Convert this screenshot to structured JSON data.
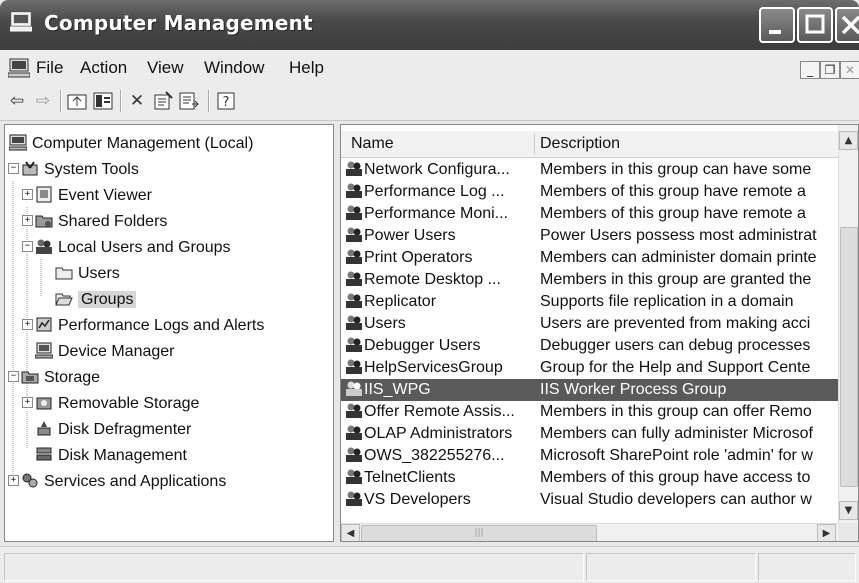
{
  "window": {
    "title": "Computer Management"
  },
  "menu": [
    "File",
    "Action",
    "View",
    "Window",
    "Help"
  ],
  "toolbar_icons": [
    "back-icon",
    "forward-icon",
    "up-icon",
    "show-hide-tree-icon",
    "delete-icon",
    "properties-icon",
    "export-list-icon",
    "help-icon"
  ],
  "tree": {
    "root": "Computer Management (Local)",
    "system_tools": "System Tools",
    "event_viewer": "Event Viewer",
    "shared_folders": "Shared Folders",
    "local_users_groups": "Local Users and Groups",
    "users": "Users",
    "groups": "Groups",
    "perf_logs": "Performance Logs and Alerts",
    "device_manager": "Device Manager",
    "storage": "Storage",
    "removable_storage": "Removable Storage",
    "disk_defrag": "Disk Defragmenter",
    "disk_mgmt": "Disk Management",
    "services_apps": "Services and Applications"
  },
  "list": {
    "columns": [
      "Name",
      "Description"
    ],
    "rows": [
      {
        "name": "Network Configura...",
        "desc": "Members in this group can have some"
      },
      {
        "name": "Performance Log ...",
        "desc": "Members of this group have remote a"
      },
      {
        "name": "Performance Moni...",
        "desc": "Members of this group have remote a"
      },
      {
        "name": "Power Users",
        "desc": "Power Users possess most administrat"
      },
      {
        "name": "Print Operators",
        "desc": "Members can administer domain printe"
      },
      {
        "name": "Remote Desktop ...",
        "desc": "Members in this group are granted the"
      },
      {
        "name": "Replicator",
        "desc": "Supports file replication in a domain"
      },
      {
        "name": "Users",
        "desc": "Users are prevented from making acci"
      },
      {
        "name": "Debugger Users",
        "desc": "Debugger users can debug processes"
      },
      {
        "name": "HelpServicesGroup",
        "desc": "Group for the Help and Support Cente"
      },
      {
        "name": "IIS_WPG",
        "desc": "IIS Worker Process Group"
      },
      {
        "name": "Offer Remote Assis...",
        "desc": "Members in this group can offer Remo"
      },
      {
        "name": "OLAP Administrators",
        "desc": "Members can fully administer Microsof"
      },
      {
        "name": "OWS_382255276...",
        "desc": "Microsoft SharePoint role 'admin' for w"
      },
      {
        "name": "TelnetClients",
        "desc": "Members of this group have access to"
      },
      {
        "name": "VS Developers",
        "desc": "Visual Studio developers can author w"
      }
    ],
    "selected_index": 10
  }
}
